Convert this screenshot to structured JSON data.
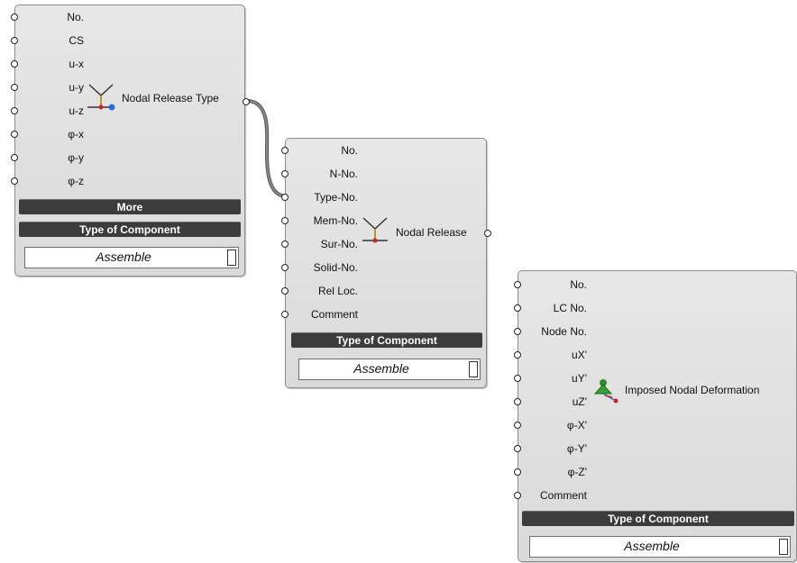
{
  "nodal_release_type": {
    "title": "Nodal Release Type",
    "inputs": [
      "No.",
      "CS",
      "u-x",
      "u-y",
      "u-z",
      "φ-x",
      "φ-y",
      "φ-z"
    ],
    "more_label": "More",
    "type_label": "Type of Component",
    "dropdown_value": "Assemble"
  },
  "nodal_release": {
    "title": "Nodal Release",
    "inputs": [
      "No.",
      "N-No.",
      "Type-No.",
      "Mem-No.",
      "Sur-No.",
      "Solid-No.",
      "Rel Loc.",
      "Comment"
    ],
    "type_label": "Type of Component",
    "dropdown_value": "Assemble"
  },
  "imposed_nodal_deformation": {
    "title": "Imposed Nodal Deformation",
    "inputs": [
      "No.",
      "LC No.",
      "Node No.",
      "uX'",
      "uY'",
      "uZ'",
      "φ-X'",
      "φ-Y'",
      "φ-Z'",
      "Comment"
    ],
    "type_label": "Type of Component",
    "dropdown_value": "Assemble"
  }
}
